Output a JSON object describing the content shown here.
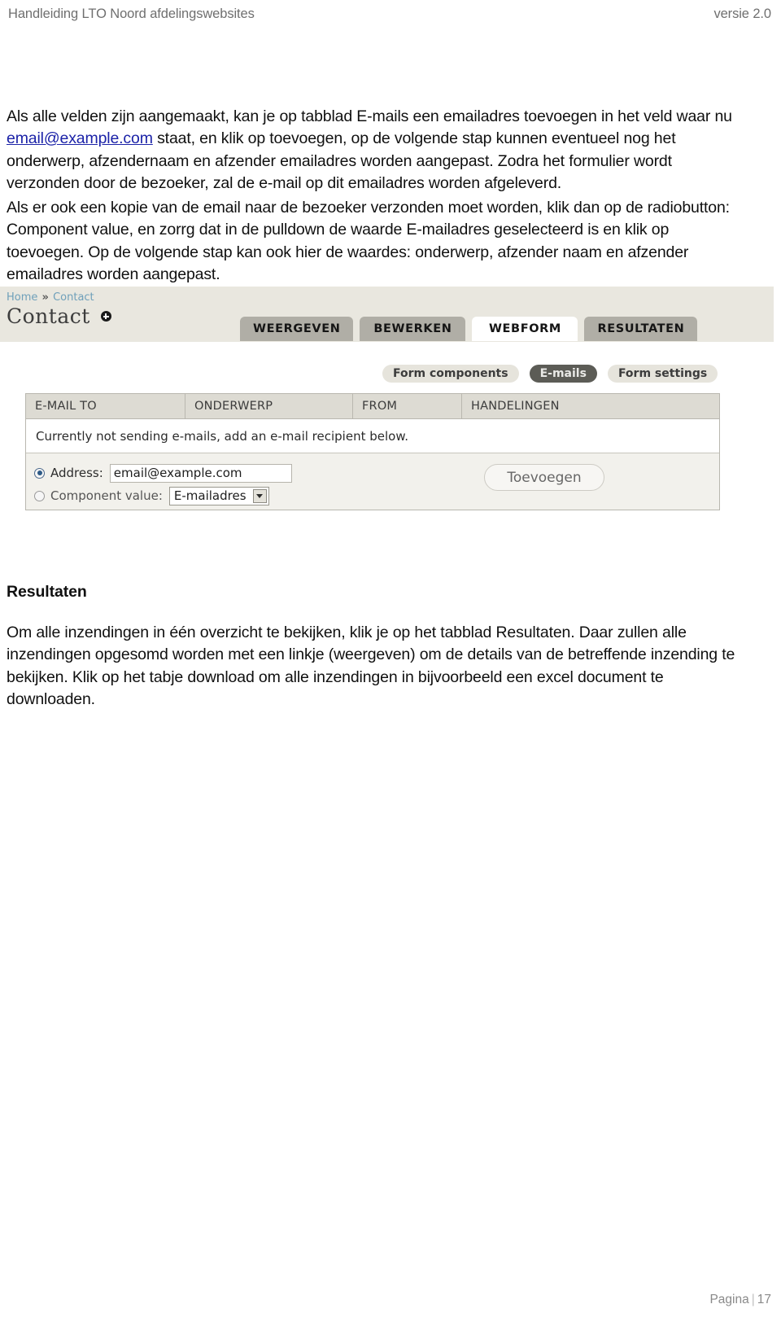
{
  "doc": {
    "header_left": "Handleiding LTO Noord afdelingswebsites",
    "header_right": "versie 2.0",
    "footer_label": "Pagina",
    "footer_page": "17"
  },
  "paragraph_1": {
    "part_a": "Als alle velden zijn aangemaakt, kan je op tabblad E-mails een emailadres toevoegen in het veld waar nu ",
    "link": "email@example.com",
    "part_b": " staat, en klik op toevoegen, op de volgende stap kunnen eventueel nog het onderwerp, afzendernaam en afzender emailadres worden aangepast. Zodra het formulier wordt verzonden door de bezoeker, zal de e-mail op dit emailadres worden afgeleverd."
  },
  "paragraph_2": {
    "text": "Als er ook een kopie van de email naar de bezoeker verzonden moet worden, klik dan op de radiobutton: Component value, en zorrg dat in de pulldown de waarde E-mailadres geselecteerd is en klik op toevoegen. Op de volgende stap kan ook hier de waardes: onderwerp, afzender naam en afzender emailadres worden aangepast."
  },
  "screenshot": {
    "breadcrumb": {
      "home": "Home",
      "separator": "»",
      "current": "Contact"
    },
    "page_title": "Contact",
    "add_icon": "plus-circle-icon",
    "tabs": [
      {
        "label": "WEERGEVEN",
        "active": false
      },
      {
        "label": "BEWERKEN",
        "active": false
      },
      {
        "label": "WEBFORM",
        "active": true
      },
      {
        "label": "RESULTATEN",
        "active": false
      }
    ],
    "subtabs": [
      {
        "label": "Form components",
        "active": false
      },
      {
        "label": "E-mails",
        "active": true
      },
      {
        "label": "Form settings",
        "active": false
      }
    ],
    "table": {
      "columns": [
        "E-MAIL TO",
        "ONDERWERP",
        "FROM",
        "HANDELINGEN"
      ],
      "notice": "Currently not sending e-mails, add an e-mail recipient below.",
      "options": {
        "address": {
          "label": "Address:",
          "selected": true,
          "value": "email@example.com",
          "placeholder": "email@example.com"
        },
        "component_value": {
          "label": "Component value:",
          "selected": false,
          "selected_option": "E-mailadres",
          "options": [
            "E-mailadres"
          ]
        }
      },
      "submit_label": "Toevoegen"
    },
    "colors": {
      "header_band": "#e9e7df",
      "tab_inactive": "#b0aea6",
      "tab_active": "#ffffff",
      "subtab_active": "#5c5c56",
      "table_header": "#dddbd3",
      "breadcrumb_link": "#7ba7bd",
      "radio_selected": "#2d5a86"
    }
  },
  "section": {
    "heading": "Resultaten",
    "text": "Om alle inzendingen in één overzicht te bekijken, klik je op het tabblad Resultaten. Daar zullen alle inzendingen opgesomd worden met een linkje (weergeven) om de details van de betreffende inzending te bekijken. Klik op het tabje download om alle inzendingen in bijvoorbeeld een excel document te downloaden."
  }
}
